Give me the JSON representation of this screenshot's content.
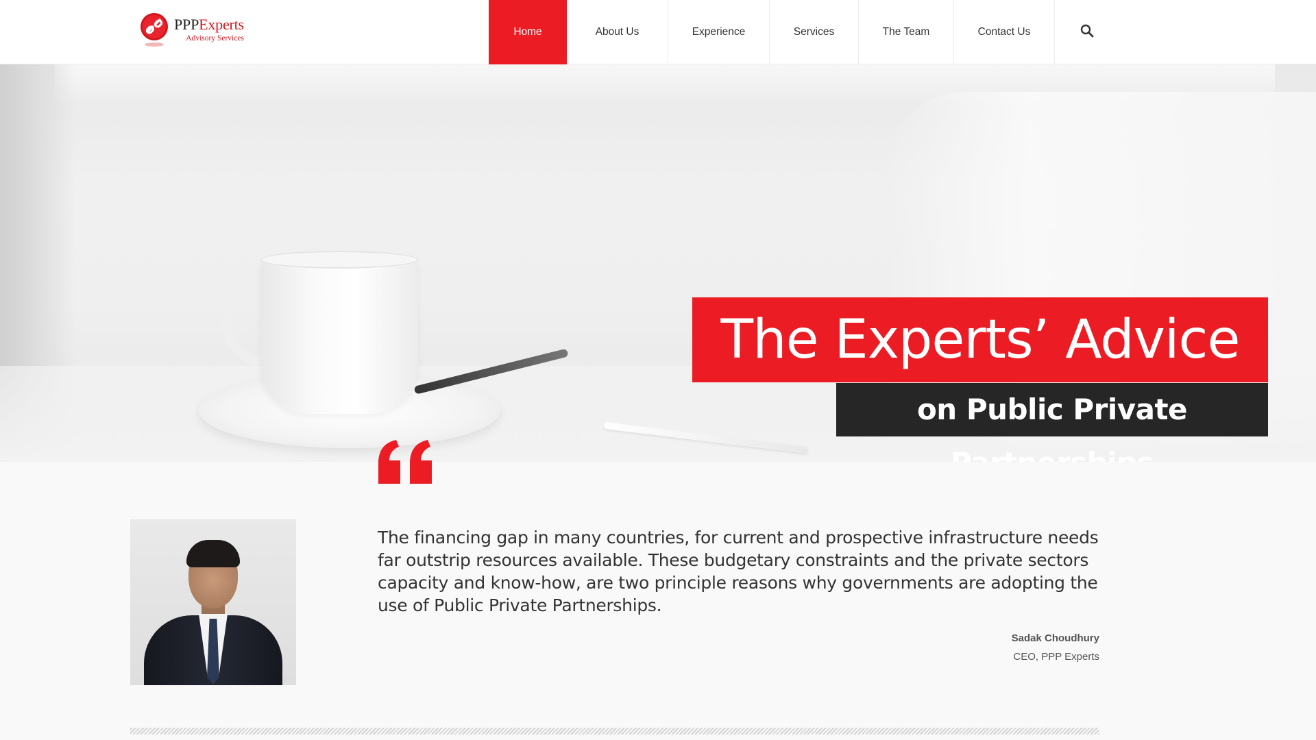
{
  "brand": {
    "name_main": "PPP",
    "name_accent": "Experts",
    "tagline": "Advisory Services",
    "accent_color": "#ec1c24"
  },
  "nav": {
    "items": [
      {
        "label": "Home",
        "active": true
      },
      {
        "label": "About Us",
        "active": false
      },
      {
        "label": "Experience",
        "active": false
      },
      {
        "label": "Services",
        "active": false
      },
      {
        "label": "The Team",
        "active": false
      },
      {
        "label": "Contact Us",
        "active": false
      }
    ],
    "search_icon": "search-icon"
  },
  "hero": {
    "title": "The Experts’ Advice",
    "subtitle": "on Public Private Partnerships"
  },
  "quote": {
    "text": "The financing gap in many countries, for current and prospective infrastructure needs far outstrip resources available. These budgetary constraints and the private sectors capacity and know-how, are two principle reasons why governments are adopting the use of Public Private Partnerships.",
    "author": "Sadak Choudhury",
    "role": "CEO, PPP Experts",
    "icon": "quote-icon"
  }
}
